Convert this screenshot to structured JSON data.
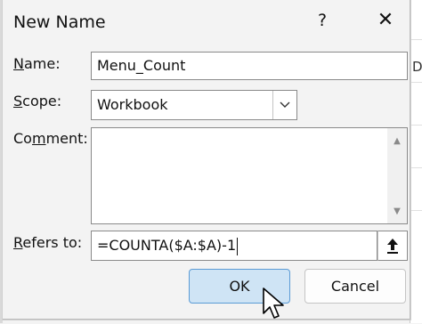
{
  "dialog": {
    "title": "New Name",
    "help_label": "?",
    "close_label": "✕"
  },
  "fields": {
    "name": {
      "label_accel": "N",
      "label_rest": "ame:",
      "value": "Menu_Count"
    },
    "scope": {
      "label_accel": "S",
      "label_rest": "cope:",
      "value": "Workbook"
    },
    "comment": {
      "label_pre": "Co",
      "label_accel": "m",
      "label_rest": "ment:",
      "value": ""
    },
    "refers_to": {
      "label_accel": "R",
      "label_rest": "efers to:",
      "value": "=COUNTA($A:$A)-1"
    }
  },
  "buttons": {
    "ok": "OK",
    "cancel": "Cancel"
  },
  "background": {
    "column_letter": "D"
  },
  "icons": {
    "scope_dropdown": "chevron-down-icon",
    "collapse": "arrow-up-icon",
    "cursor": "mouse-pointer-icon"
  },
  "colors": {
    "ok_fill": "#cfe4f5",
    "ok_border": "#5b9bd5",
    "dialog_bg": "#f3f3f3"
  }
}
